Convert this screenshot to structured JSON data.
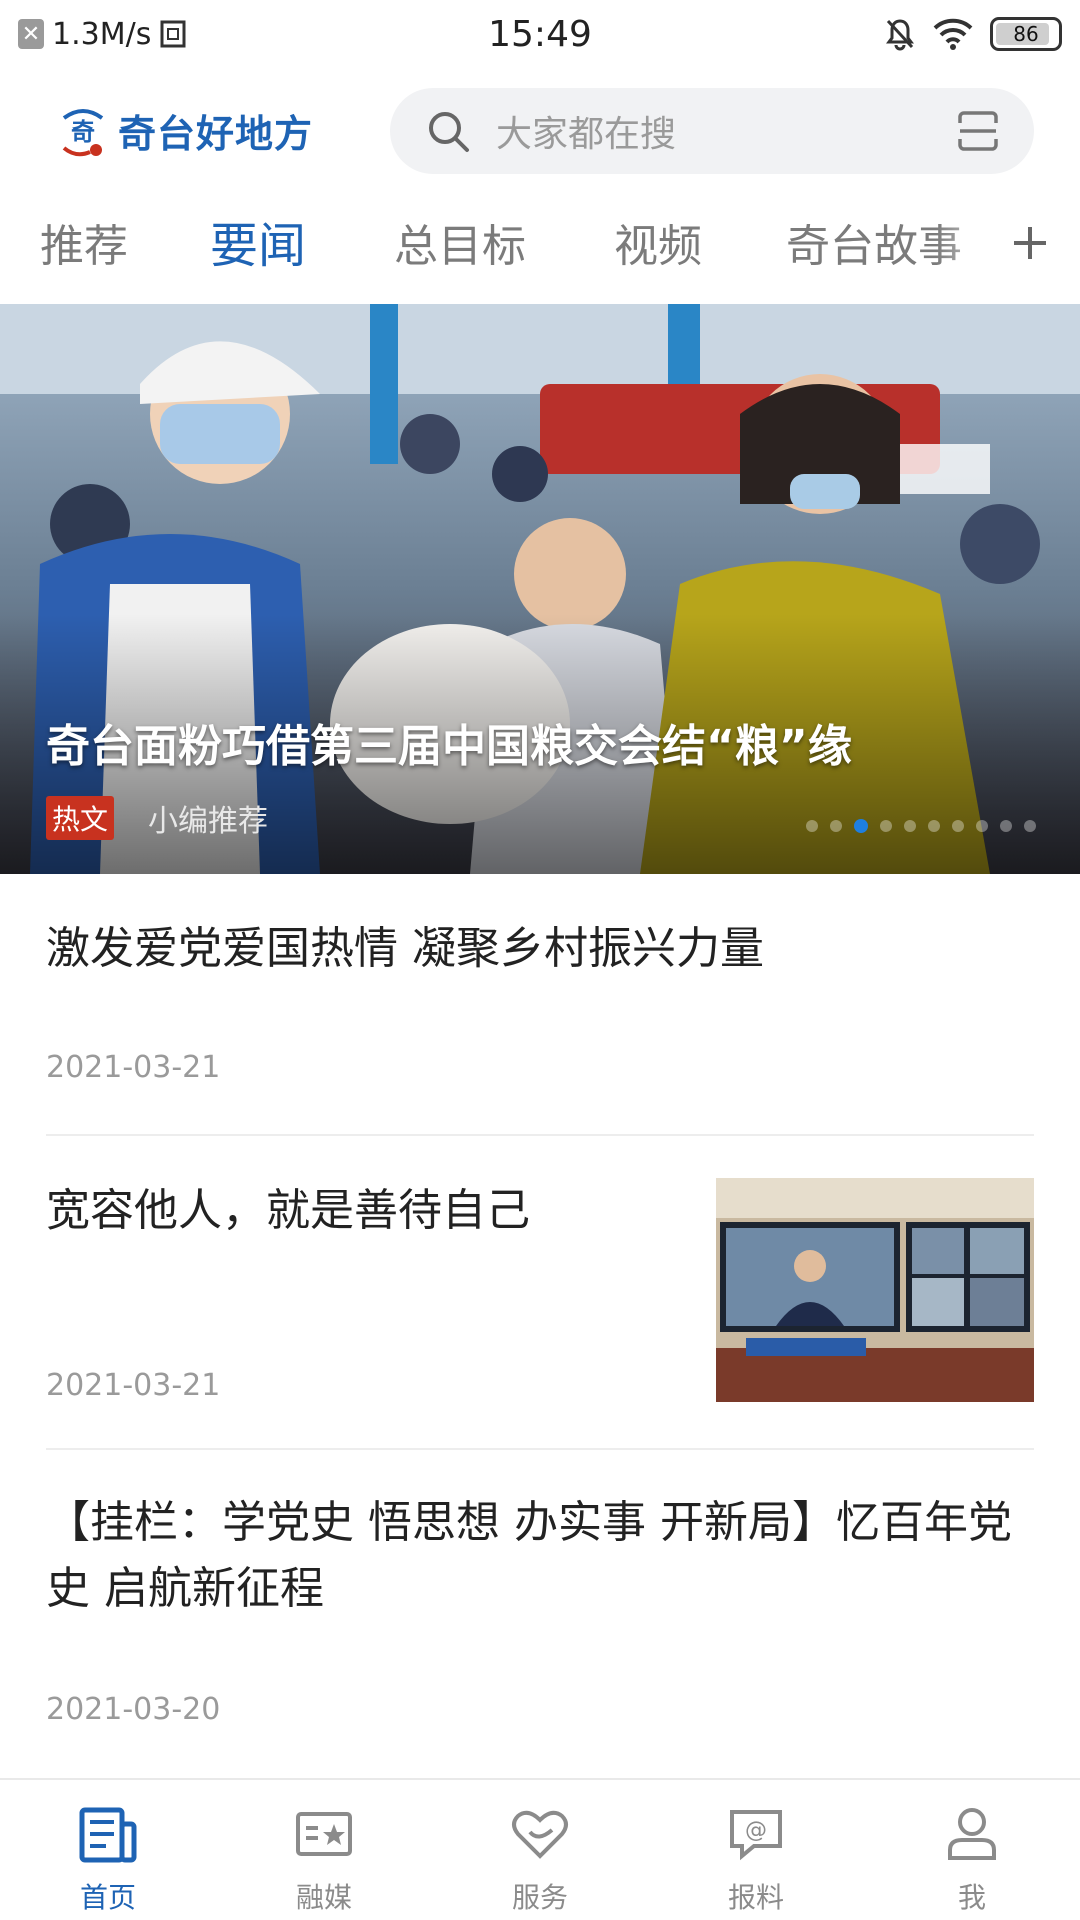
{
  "status_bar": {
    "network_speed": "1.3M/s",
    "time": "15:49",
    "battery": "86",
    "icons": [
      "notification-x-icon",
      "sim-icon",
      "mute-bell-icon",
      "wifi-icon",
      "battery-icon"
    ]
  },
  "header": {
    "app_title": "奇台好地方",
    "search_placeholder": "大家都在搜",
    "icons": [
      "app-logo",
      "search-icon",
      "scan-icon"
    ]
  },
  "tabs": [
    {
      "label": "推荐",
      "active": false
    },
    {
      "label": "要闻",
      "active": true
    },
    {
      "label": "总目标",
      "active": false
    },
    {
      "label": "视频",
      "active": false
    },
    {
      "label": "奇台故事",
      "active": false
    }
  ],
  "hero": {
    "title": "奇台面粉巧借第三届中国粮交会结“粮”缘",
    "tag": "热文",
    "source": "小编推荐",
    "slide_count": 10,
    "active_slide": 3
  },
  "articles": [
    {
      "title": "激发爱党爱国热情 凝聚乡村振兴力量",
      "date": "2021-03-21",
      "has_thumb": false
    },
    {
      "title": "宽容他人，就是善待自己",
      "date": "2021-03-21",
      "has_thumb": true
    },
    {
      "title": "【挂栏：学党史 悟思想 办实事 开新局】忆百年党史 启航新征程",
      "date": "2021-03-20",
      "has_thumb": false
    }
  ],
  "bottom_nav": [
    {
      "label": "首页",
      "icon": "news-icon",
      "active": true
    },
    {
      "label": "融媒",
      "icon": "media-card-icon",
      "active": false
    },
    {
      "label": "服务",
      "icon": "heart-service-icon",
      "active": false
    },
    {
      "label": "报料",
      "icon": "report-at-icon",
      "active": false
    },
    {
      "label": "我",
      "icon": "user-icon",
      "active": false
    }
  ],
  "colors": {
    "accent": "#1e63b4",
    "tag_red": "#c8321f",
    "inactive_text": "#7b7b7b",
    "date_text": "#9a9a9a"
  }
}
